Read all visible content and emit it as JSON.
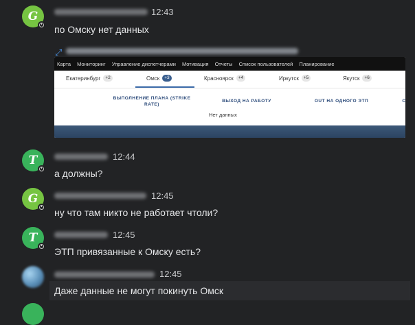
{
  "colors": {
    "background": "#222325",
    "avatar_green": "#76c442",
    "avatar_teal": "#39b35b",
    "text": "#e4e5e7",
    "link": "#4a8fe0"
  },
  "messages": [
    {
      "avatar_letter": "G",
      "time": "12:43",
      "text": "по Омску нет данных"
    },
    {
      "avatar_letter": "T",
      "time": "12:44",
      "text": "а должны?"
    },
    {
      "avatar_letter": "G",
      "time": "12:45",
      "text": "ну что там никто не работает чтоли?"
    },
    {
      "avatar_letter": "T",
      "time": "12:45",
      "text": "ЭТП привязанные к Омску есть?"
    },
    {
      "avatar_letter": "",
      "time": "12:45",
      "text": "Даже данные не могут покинуть Омск"
    }
  ],
  "attachment": {
    "icon": "expand-arrow-icon",
    "nav": [
      "Карта",
      "Мониторинг",
      "Управление диспетчерами",
      "Мотивация",
      "Отчеты",
      "Список пользователей",
      "Планирование"
    ],
    "tabs": [
      {
        "label": "Екатеринбург",
        "badge": "+2"
      },
      {
        "label": "Омск",
        "badge": "+3"
      },
      {
        "label": "Красноярск",
        "badge": "+4"
      },
      {
        "label": "Иркутск",
        "badge": "+5"
      },
      {
        "label": "Якутск",
        "badge": "+6"
      }
    ],
    "active_tab": "Омск",
    "columns": [
      "ВЫПОЛНЕНИЕ ПЛАНА (STRIKE RATE)",
      "ВЫХОД НА РАБОТУ",
      "OUT НА ОДНОГО ЭТП",
      "С"
    ],
    "empty_text": "Нет данных"
  }
}
